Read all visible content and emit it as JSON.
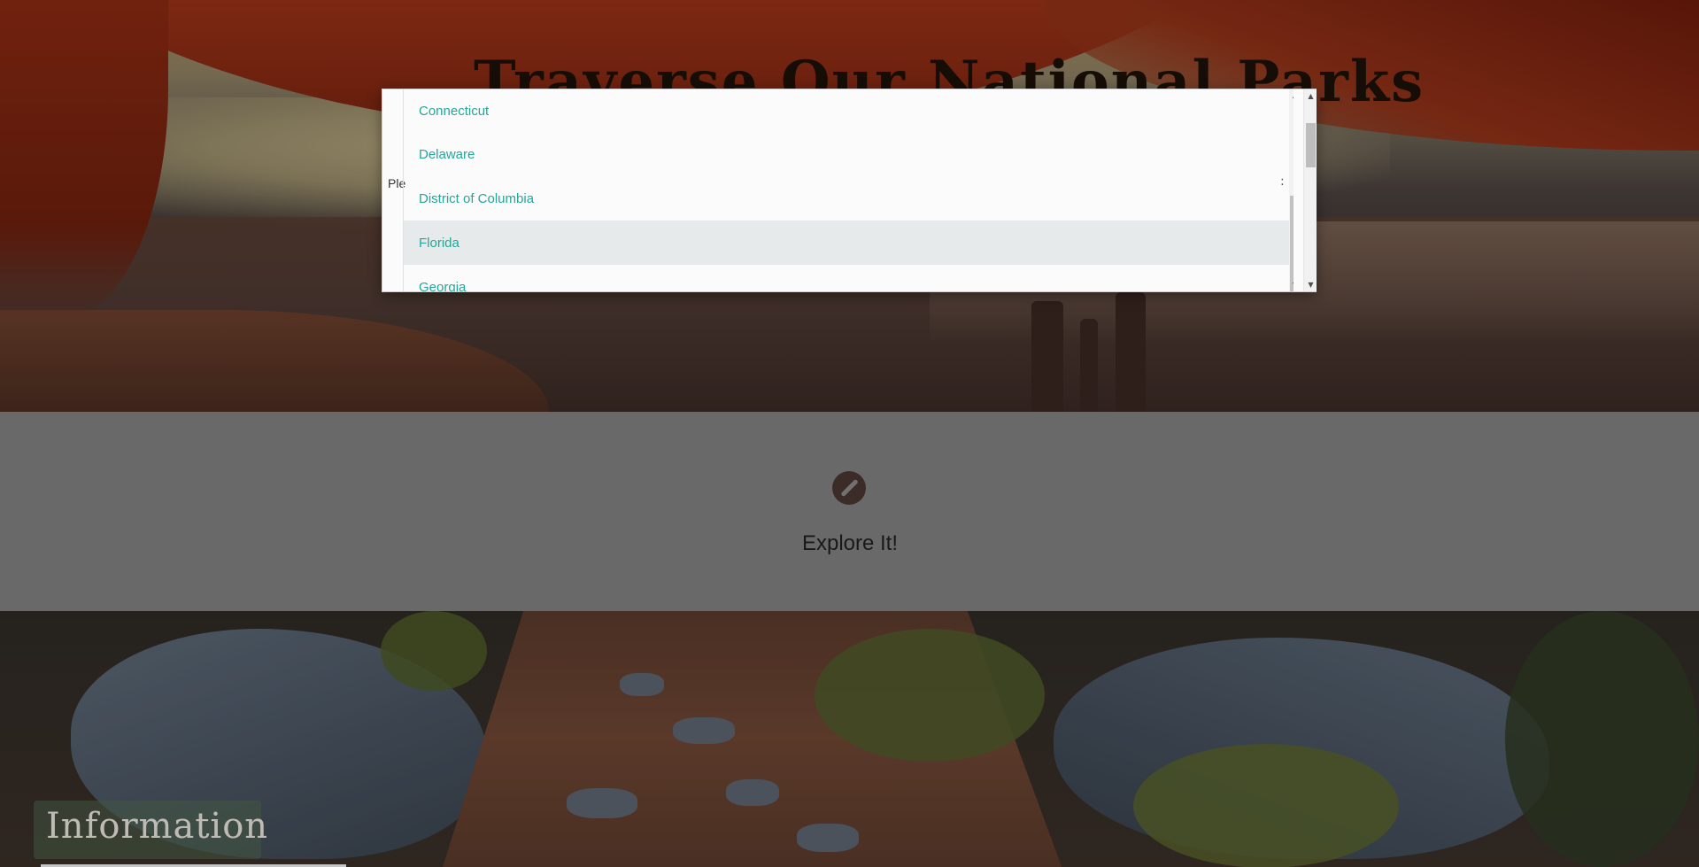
{
  "hero": {
    "title": "Traverse Our National Parks"
  },
  "explore": {
    "icon": "compass-icon",
    "label": "Explore It!"
  },
  "information": {
    "label": "Information"
  },
  "modal": {
    "prompt_fragment": "Ple",
    "states": [
      "Connecticut",
      "Delaware",
      "District of Columbia",
      "Florida",
      "Georgia"
    ],
    "highlighted_state": "Florida"
  },
  "colors": {
    "link_teal": "#26a69a",
    "highlight_row": "#e6eaea",
    "band_grey": "#808080",
    "compass_brown": "#4a3630",
    "top_accent": "#5a2e86"
  }
}
